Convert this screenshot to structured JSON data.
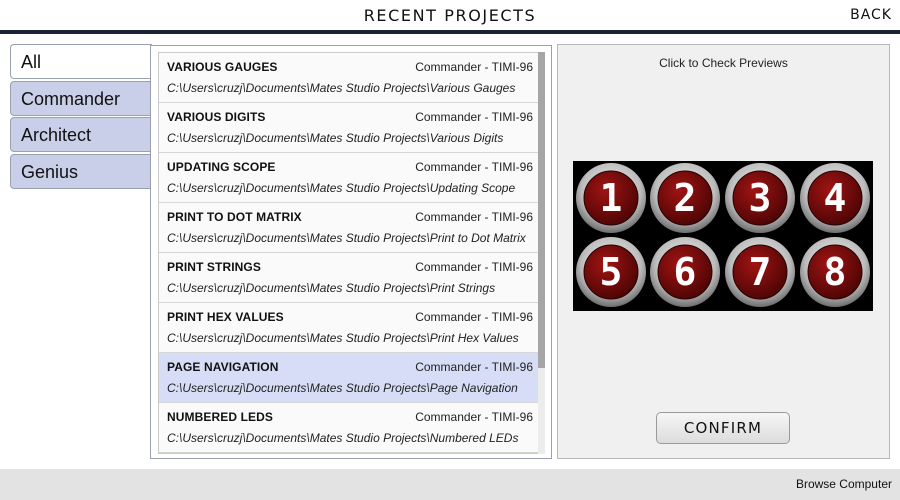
{
  "header": {
    "title": "RECENT PROJECTS",
    "back_label": "BACK"
  },
  "tabs": [
    {
      "label": "All",
      "active": true
    },
    {
      "label": "Commander",
      "active": false
    },
    {
      "label": "Architect",
      "active": false
    },
    {
      "label": "Genius",
      "active": false
    }
  ],
  "projects": [
    {
      "title": "VARIOUS GAUGES",
      "device": "Commander - TIMI-96",
      "path": "C:\\Users\\cruzj\\Documents\\Mates Studio Projects\\Various Gauges",
      "selected": false
    },
    {
      "title": "VARIOUS DIGITS",
      "device": "Commander - TIMI-96",
      "path": "C:\\Users\\cruzj\\Documents\\Mates Studio Projects\\Various Digits",
      "selected": false
    },
    {
      "title": "UPDATING SCOPE",
      "device": "Commander - TIMI-96",
      "path": "C:\\Users\\cruzj\\Documents\\Mates Studio Projects\\Updating Scope",
      "selected": false
    },
    {
      "title": "PRINT TO DOT MATRIX",
      "device": "Commander - TIMI-96",
      "path": "C:\\Users\\cruzj\\Documents\\Mates Studio Projects\\Print to Dot Matrix",
      "selected": false
    },
    {
      "title": "PRINT STRINGS",
      "device": "Commander - TIMI-96",
      "path": "C:\\Users\\cruzj\\Documents\\Mates Studio Projects\\Print Strings",
      "selected": false
    },
    {
      "title": "PRINT HEX VALUES",
      "device": "Commander - TIMI-96",
      "path": "C:\\Users\\cruzj\\Documents\\Mates Studio Projects\\Print Hex Values",
      "selected": false
    },
    {
      "title": "PAGE NAVIGATION",
      "device": "Commander - TIMI-96",
      "path": "C:\\Users\\cruzj\\Documents\\Mates Studio Projects\\Page Navigation",
      "selected": true
    },
    {
      "title": "NUMBERED LEDS",
      "device": "Commander - TIMI-96",
      "path": "C:\\Users\\cruzj\\Documents\\Mates Studio Projects\\Numbered LEDs",
      "selected": false
    }
  ],
  "preview": {
    "caption": "Click to Check Previews",
    "buttons": [
      "1",
      "2",
      "3",
      "4",
      "5",
      "6",
      "7",
      "8"
    ],
    "button_color": "#7a0a0a",
    "confirm_label": "CONFIRM"
  },
  "footer": {
    "browse_label": "Browse Computer"
  },
  "colors": {
    "header_rule": "#1c2236",
    "tab_inactive": "#c9cfe9",
    "row_selected": "#d7ddf6"
  }
}
